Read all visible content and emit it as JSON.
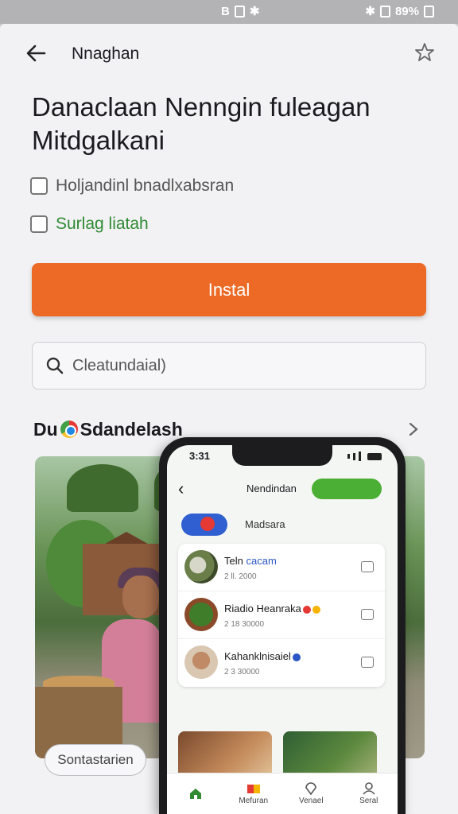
{
  "statusbar": {
    "left_text": "B",
    "battery": "89%"
  },
  "topbar": {
    "title": "Nnaghan"
  },
  "app": {
    "title": "Danaclaan Nenngin fuleagan Mitdgalkani"
  },
  "checks": [
    {
      "label": "Holjandinl bnadlxabsran"
    },
    {
      "label": "Surlag liatah"
    }
  ],
  "install_label": "Instal",
  "search": {
    "value": "Cleatundaial)"
  },
  "section": {
    "title_prefix": "Du",
    "title_suffix": "Sdandelash"
  },
  "chip_label": "Sontastarien",
  "phone": {
    "time": "3:31",
    "title": "Nendindan",
    "subtitle": "Madsara",
    "items": [
      {
        "name": "Teln",
        "tag": "cacam",
        "sub": "2 ll. 2000"
      },
      {
        "name": "Riadio Heanraka",
        "tag": "",
        "sub": "2 18 30000"
      },
      {
        "name": "Kahanklnisaiel",
        "tag": "",
        "sub": "2 3 30000"
      }
    ],
    "nav": [
      {
        "label": ""
      },
      {
        "label": "Mefuran"
      },
      {
        "label": "Venael"
      },
      {
        "label": "Seral"
      }
    ]
  },
  "colors": {
    "accent": "#ec6a25",
    "green": "#4caf35",
    "blue": "#2f5fd0"
  }
}
